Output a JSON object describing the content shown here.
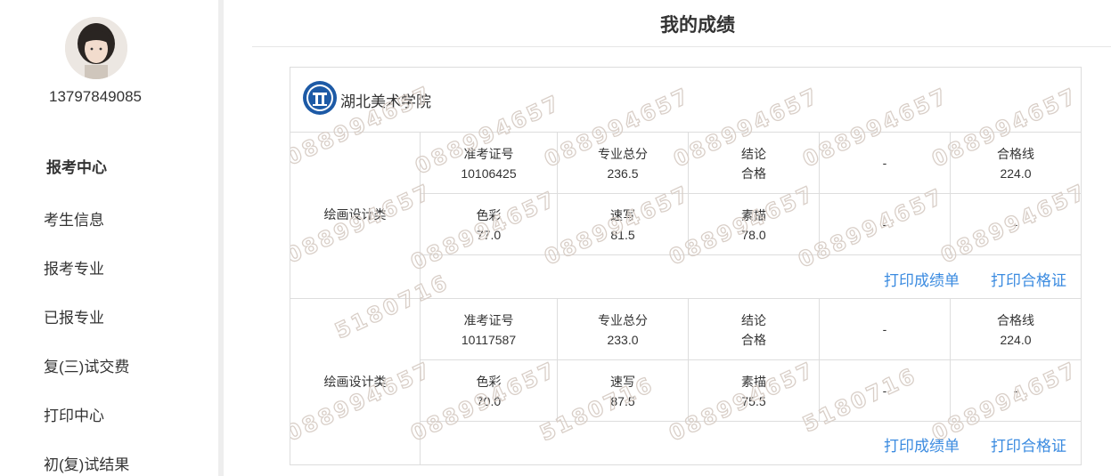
{
  "user": {
    "phone": "13797849085"
  },
  "nav": {
    "heading": "报考中心",
    "items": [
      "考生信息",
      "报考专业",
      "已报专业",
      "复(三)试交费",
      "打印中心",
      "初(复)试结果"
    ]
  },
  "page": {
    "title": "我的成绩"
  },
  "school": {
    "name": "湖北美术学院"
  },
  "records": [
    {
      "category": "绘画设计类",
      "exam_no_label": "准考证号",
      "exam_no": "10106425",
      "total_label": "专业总分",
      "total": "236.5",
      "result_label": "结论",
      "result": "合格",
      "extra": "-",
      "pass_label": "合格线",
      "pass": "224.0",
      "s1_label": "色彩",
      "s1": "77.0",
      "s2_label": "速写",
      "s2": "81.5",
      "s3_label": "素描",
      "s3": "78.0",
      "blank1": "-",
      "blank2": "-",
      "print_score": "打印成绩单",
      "print_cert": "打印合格证"
    },
    {
      "category": "绘画设计类",
      "exam_no_label": "准考证号",
      "exam_no": "10117587",
      "total_label": "专业总分",
      "total": "233.0",
      "result_label": "结论",
      "result": "合格",
      "extra": "-",
      "pass_label": "合格线",
      "pass": "224.0",
      "s1_label": "色彩",
      "s1": "70.0",
      "s2_label": "速写",
      "s2": "87.5",
      "s3_label": "素描",
      "s3": "75.5",
      "blank1": "-",
      "blank2": "-",
      "print_score": "打印成绩单",
      "print_cert": "打印合格证"
    }
  ],
  "watermark": {
    "text": "088994657",
    "text2": "5180716"
  },
  "colors": {
    "link": "#3b8be0",
    "border": "#dddddd",
    "watermark": "#d9cfc8"
  }
}
